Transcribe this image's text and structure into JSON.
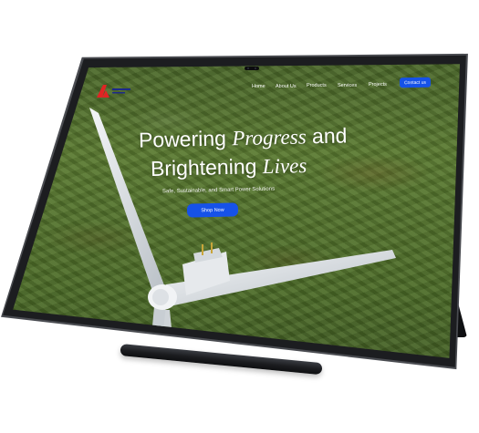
{
  "nav": {
    "items": [
      {
        "label": "Home"
      },
      {
        "label": "About Us"
      },
      {
        "label": "Products"
      },
      {
        "label": "Services"
      },
      {
        "label": "Projects"
      }
    ],
    "contact_label": "Contact us"
  },
  "hero": {
    "line1_regular": "Powering",
    "line1_italic": "Progress",
    "line1_end": "and",
    "line2_regular": "Brightening",
    "line2_italic": "Lives",
    "subtitle": "Safe, Sustainable, and Smart Power Solutions",
    "cta_label": "Shop Now"
  },
  "colors": {
    "accent": "#1652e8",
    "logo_red": "#e02424"
  },
  "icons": {
    "logo": "brand-logo",
    "camera": "front-camera"
  }
}
